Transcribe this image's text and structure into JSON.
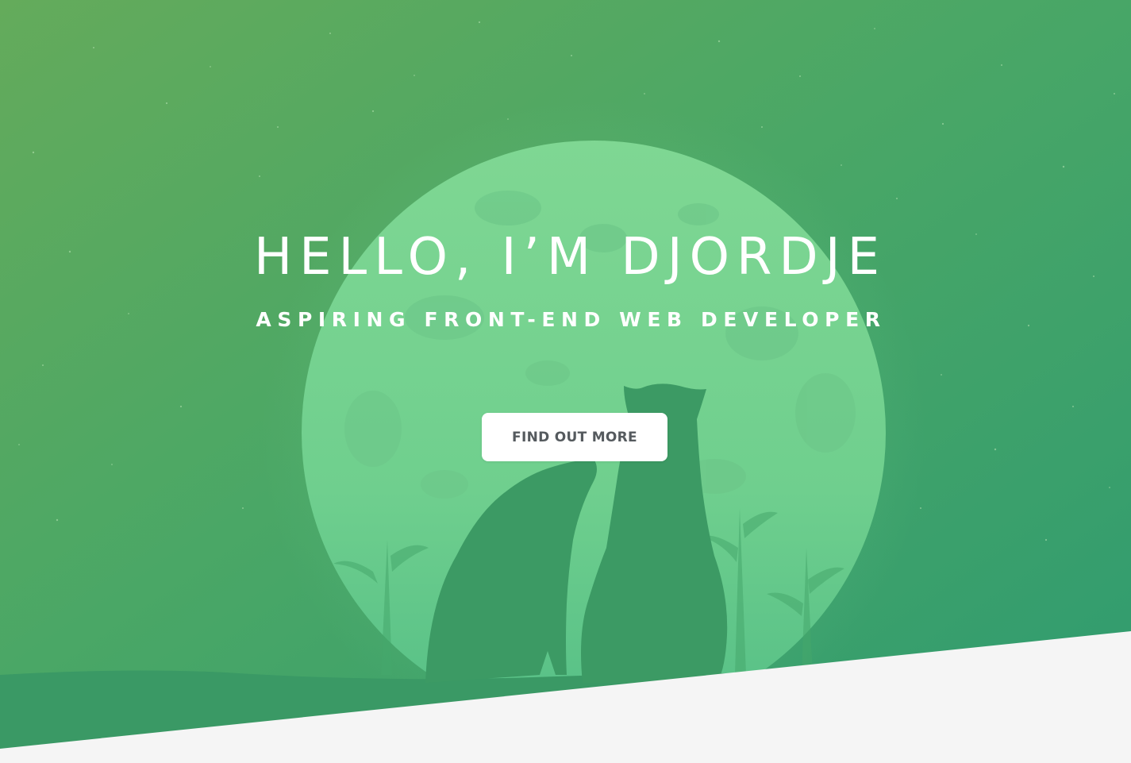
{
  "hero": {
    "title": "HELLO, I’M DJORDJE",
    "subtitle": "ASPIRING FRONT-END WEB DEVELOPER",
    "cta_label": "FIND OUT MORE",
    "background_image": "moon-with-two-cats-silhouette"
  },
  "colors": {
    "gradient_top_left": "#62ab5c",
    "gradient_bottom_right": "#33a06e",
    "moon": "#7ed798",
    "silhouette": "#3c9a64",
    "page_background": "#f5f5f5",
    "button_background": "#ffffff",
    "button_text": "#555a5e",
    "hero_text": "#ffffff"
  }
}
